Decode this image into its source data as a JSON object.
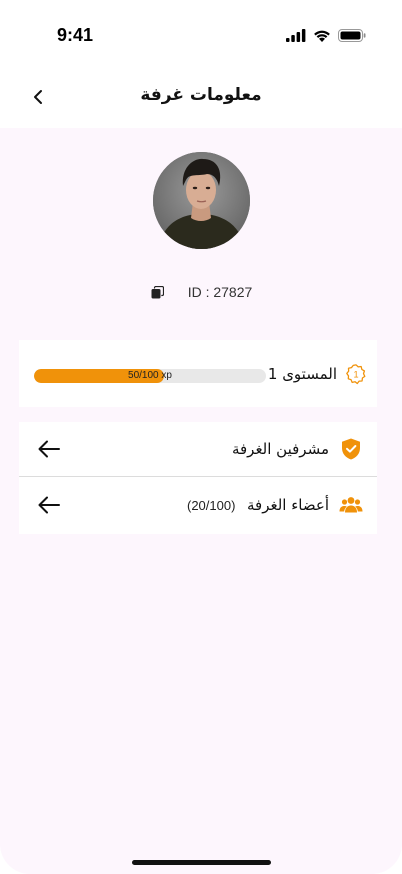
{
  "status_bar": {
    "time": "9:41"
  },
  "header": {
    "title": "معلومات غرفة",
    "back_icon": "chevron-left-icon"
  },
  "profile": {
    "id_text": "ID : 27827",
    "copy_icon": "copy-icon"
  },
  "level": {
    "label": "المستوى 1",
    "progress_text": "50/100 xp",
    "progress_fraction": 0.5,
    "icon": "level-badge-icon",
    "accent_color": "#f0920a"
  },
  "list": {
    "admins_label": "مشرفين الغرفة",
    "admins_icon": "shield-check-icon",
    "members_label": "أعضاء الغرفة",
    "members_count": "(20/100)",
    "members_icon": "users-icon",
    "arrow_icon": "arrow-left-icon"
  },
  "colors": {
    "accent": "#f0920a",
    "background": "#fdf6fd"
  }
}
